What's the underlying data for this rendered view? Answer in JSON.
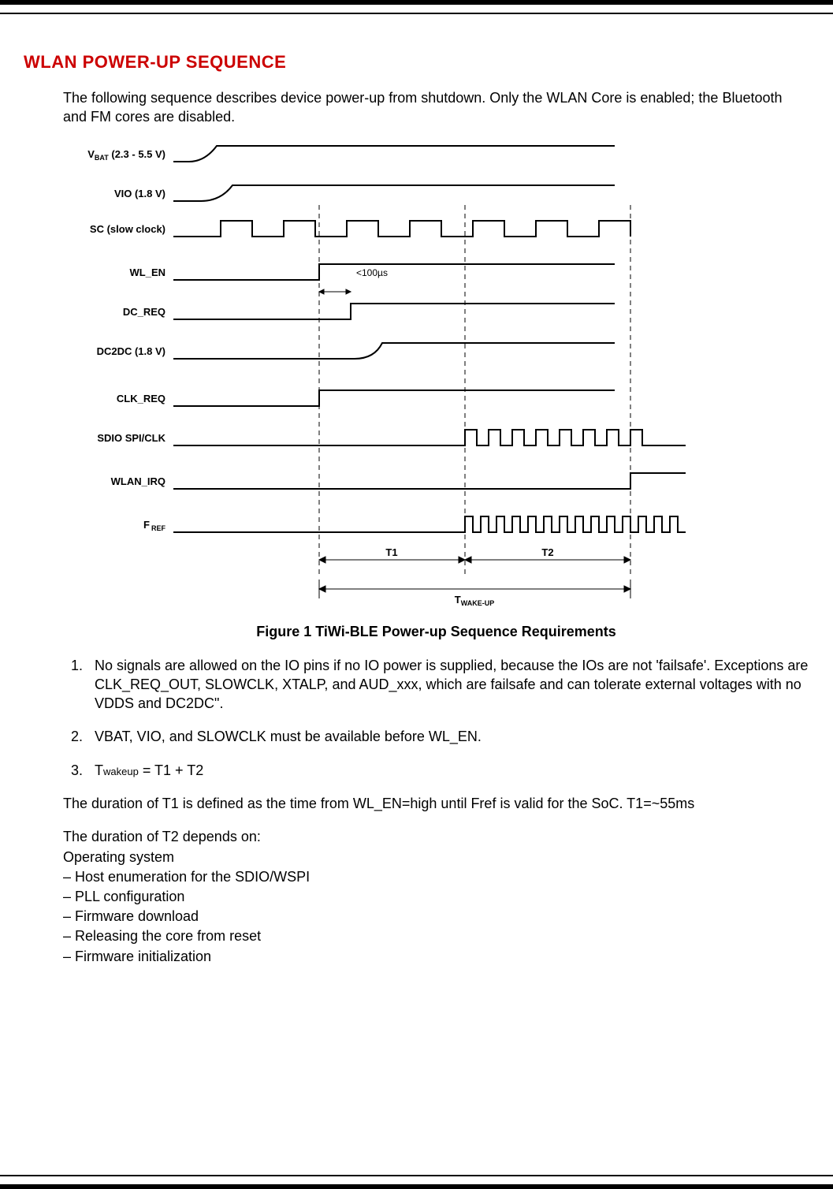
{
  "section_title": "WLAN POWER-UP SEQUENCE",
  "intro": "The following sequence describes device power-up from shutdown.  Only the WLAN Core is enabled; the Bluetooth and FM cores are disabled.",
  "figure": {
    "signals": {
      "vbat": "VBAT (2.3 - 5.5 V)",
      "vio": "VIO (1.8 V)",
      "sc": "SC (slow clock)",
      "wl_en": "WL_EN",
      "dc_req": "DC_REQ",
      "dc2dc": "DC2DC (1.8 V)",
      "clk_req": "CLK_REQ",
      "sdio": "SDIO SPI/CLK",
      "wlan_irq": "WLAN_IRQ",
      "fref_main": "F",
      "fref_sub": "REF"
    },
    "annot_100us": "<100µs",
    "t1": "T1",
    "t2": "T2",
    "twake_main": "T",
    "twake_sub": "WAKE-UP",
    "caption": "Figure 1 TiWi-BLE Power-up Sequence Requirements"
  },
  "numbered_items": {
    "i1": "No signals are allowed on the IO pins if no IO power is supplied, because the IOs are not 'failsafe'. Exceptions are CLK_REQ_OUT, SLOWCLK, XTALP, and AUD_xxx, which are failsafe and can tolerate external voltages with no VDDS and DC2DC\".",
    "i2": "VBAT, VIO, and SLOWCLK must be available before WL_EN.",
    "i3_pre": "T",
    "i3_sub": "wakeup",
    "i3_post": " = T1 + T2"
  },
  "t1_para": "The duration of T1 is defined as the time from WL_EN=high until Fref is valid for the SoC.  T1=~55ms",
  "t2_intro": "The duration of T2 depends on:",
  "t2_list": {
    "l0": " Operating system",
    "l1": "– Host enumeration for the SDIO/WSPI",
    "l2": "– PLL configuration",
    "l3": "– Firmware download",
    "l4": "– Releasing the core from reset",
    "l5": "– Firmware initialization"
  }
}
